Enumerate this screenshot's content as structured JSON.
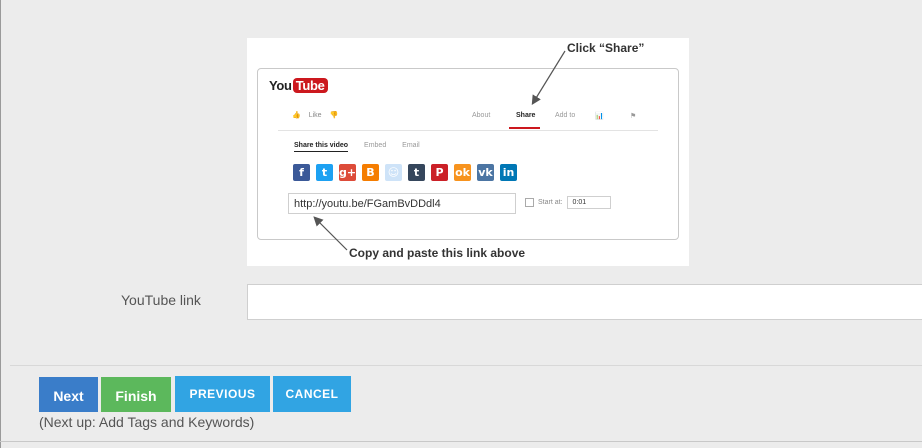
{
  "instruction": {
    "callout_share": "Click “Share”",
    "callout_link": "Copy and paste this link above",
    "youtube_logo": {
      "you": "You",
      "tube": "Tube"
    },
    "actions": {
      "like": "Like"
    },
    "tabs": [
      "About",
      "Share",
      "Add to"
    ],
    "sub_tabs": [
      "Share this video",
      "Embed",
      "Email"
    ],
    "social_icons": [
      {
        "name": "facebook-icon",
        "glyph": "f",
        "color": "#3b5998"
      },
      {
        "name": "twitter-icon",
        "glyph": "t",
        "color": "#1da1f2"
      },
      {
        "name": "google-plus-icon",
        "glyph": "g+",
        "color": "#dd4b39"
      },
      {
        "name": "blogger-icon",
        "glyph": "B",
        "color": "#f57d00"
      },
      {
        "name": "reddit-icon",
        "glyph": "☺",
        "color": "#cee3f8"
      },
      {
        "name": "tumblr-icon",
        "glyph": "t",
        "color": "#35465c"
      },
      {
        "name": "pinterest-icon",
        "glyph": "P",
        "color": "#cb2027"
      },
      {
        "name": "odnoklassniki-icon",
        "glyph": "ok",
        "color": "#f7931e"
      },
      {
        "name": "vk-icon",
        "glyph": "vk",
        "color": "#4c75a3"
      },
      {
        "name": "linkedin-icon",
        "glyph": "in",
        "color": "#0077b5"
      }
    ],
    "link_value": "http://youtu.be/FGamBvDDdl4",
    "start_at_label": "Start at:",
    "start_at_value": "0:01"
  },
  "form": {
    "youtube_link_label": "YouTube link",
    "youtube_link_value": "",
    "youtube_link_placeholder": ""
  },
  "buttons": {
    "next": "Next",
    "finish": "Finish",
    "previous": "PREVIOUS",
    "cancel": "CANCEL"
  },
  "next_up": "(Next up: Add Tags and Keywords)"
}
